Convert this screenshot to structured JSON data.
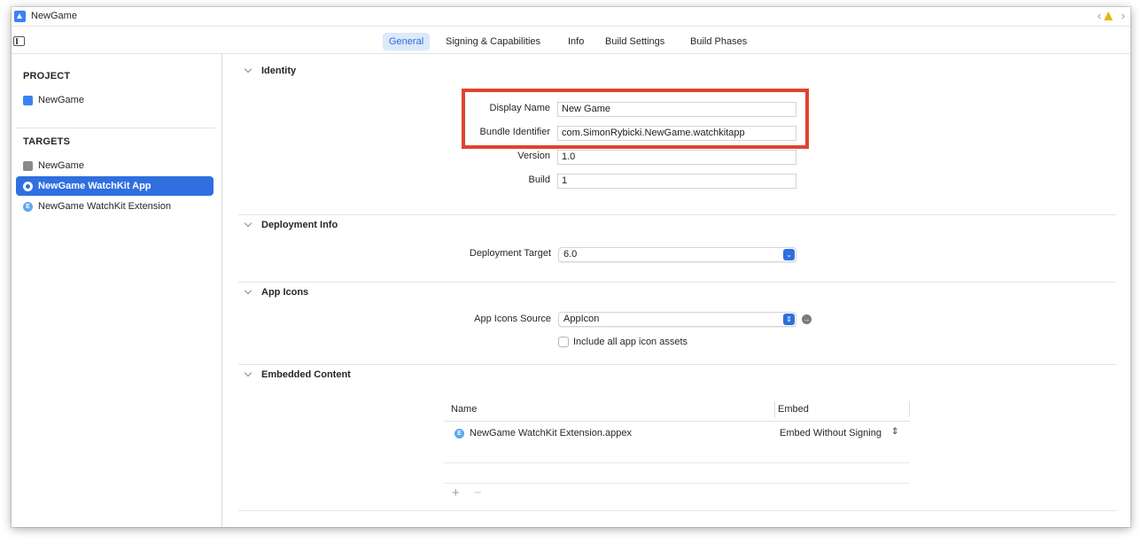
{
  "window": {
    "title": "NewGame"
  },
  "tabs": [
    {
      "label": "General",
      "active": true
    },
    {
      "label": "Signing & Capabilities",
      "active": false
    },
    {
      "label": "Info",
      "active": false
    },
    {
      "label": "Build Settings",
      "active": false
    },
    {
      "label": "Build Phases",
      "active": false
    }
  ],
  "sidebar": {
    "project_header": "PROJECT",
    "project_item": "NewGame",
    "targets_header": "TARGETS",
    "targets": [
      {
        "label": "NewGame",
        "selected": false
      },
      {
        "label": "NewGame WatchKit App",
        "selected": true
      },
      {
        "label": "NewGame WatchKit Extension",
        "selected": false
      }
    ]
  },
  "identity": {
    "title": "Identity",
    "display_name_label": "Display Name",
    "display_name_value": "New Game",
    "bundle_id_label": "Bundle Identifier",
    "bundle_id_value": "com.SimonRybicki.NewGame.watchkitapp",
    "version_label": "Version",
    "version_value": "1.0",
    "build_label": "Build",
    "build_value": "1"
  },
  "deployment": {
    "title": "Deployment Info",
    "target_label": "Deployment Target",
    "target_value": "6.0"
  },
  "app_icons": {
    "title": "App Icons",
    "source_label": "App Icons Source",
    "source_value": "AppIcon",
    "include_label": "Include all app icon assets",
    "include_checked": false
  },
  "embedded": {
    "title": "Embedded Content",
    "col_name": "Name",
    "col_embed": "Embed",
    "rows": [
      {
        "name": "NewGame WatchKit Extension.appex",
        "embed": "Embed Without Signing"
      }
    ],
    "add_label": "+",
    "remove_label": "−"
  },
  "colors": {
    "accent": "#2f6fe0",
    "highlight_box": "#e0432f"
  }
}
